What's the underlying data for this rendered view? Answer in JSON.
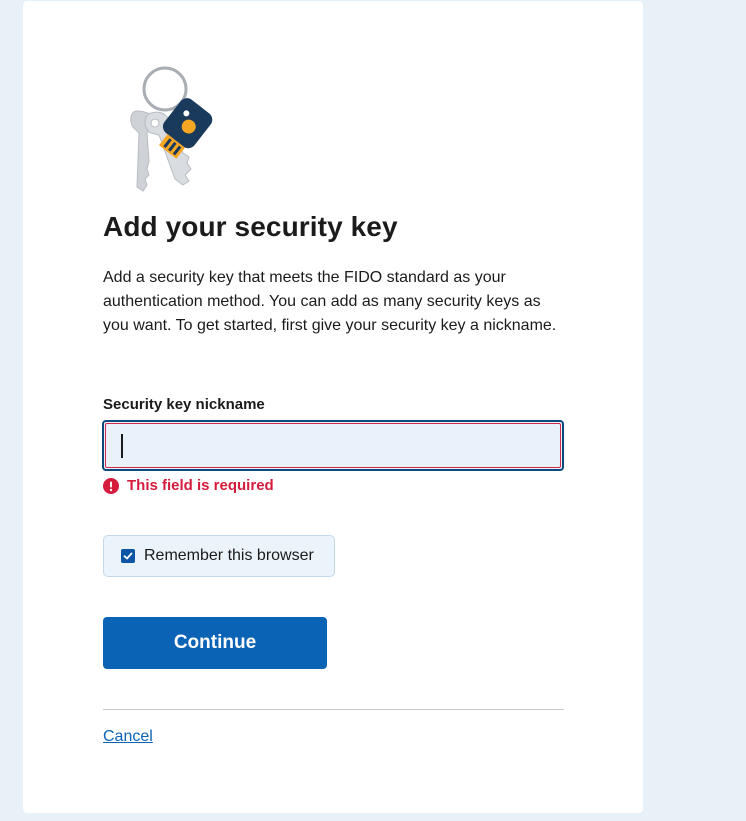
{
  "page": {
    "title": "Add your security key",
    "intro": "Add a security key that meets the FIDO standard as your authentication method. You can add as many security keys as you want. To get started, first give your security key a nickname."
  },
  "form": {
    "nickname_label": "Security key nickname",
    "nickname_value": "",
    "error_message": "This field is required",
    "remember_label": "Remember this browser",
    "remember_checked": true,
    "continue_label": "Continue",
    "cancel_label": "Cancel"
  },
  "icons": {
    "illustration": "security-key-illustration-icon",
    "error": "exclamation-circle-icon",
    "checkbox": "check-icon"
  },
  "colors": {
    "page_background": "#e8f0f8",
    "primary": "#0b63b6",
    "error": "#d51c3d",
    "input_border": "#0b4a7d",
    "checkbox_background": "#ebf3fb"
  }
}
